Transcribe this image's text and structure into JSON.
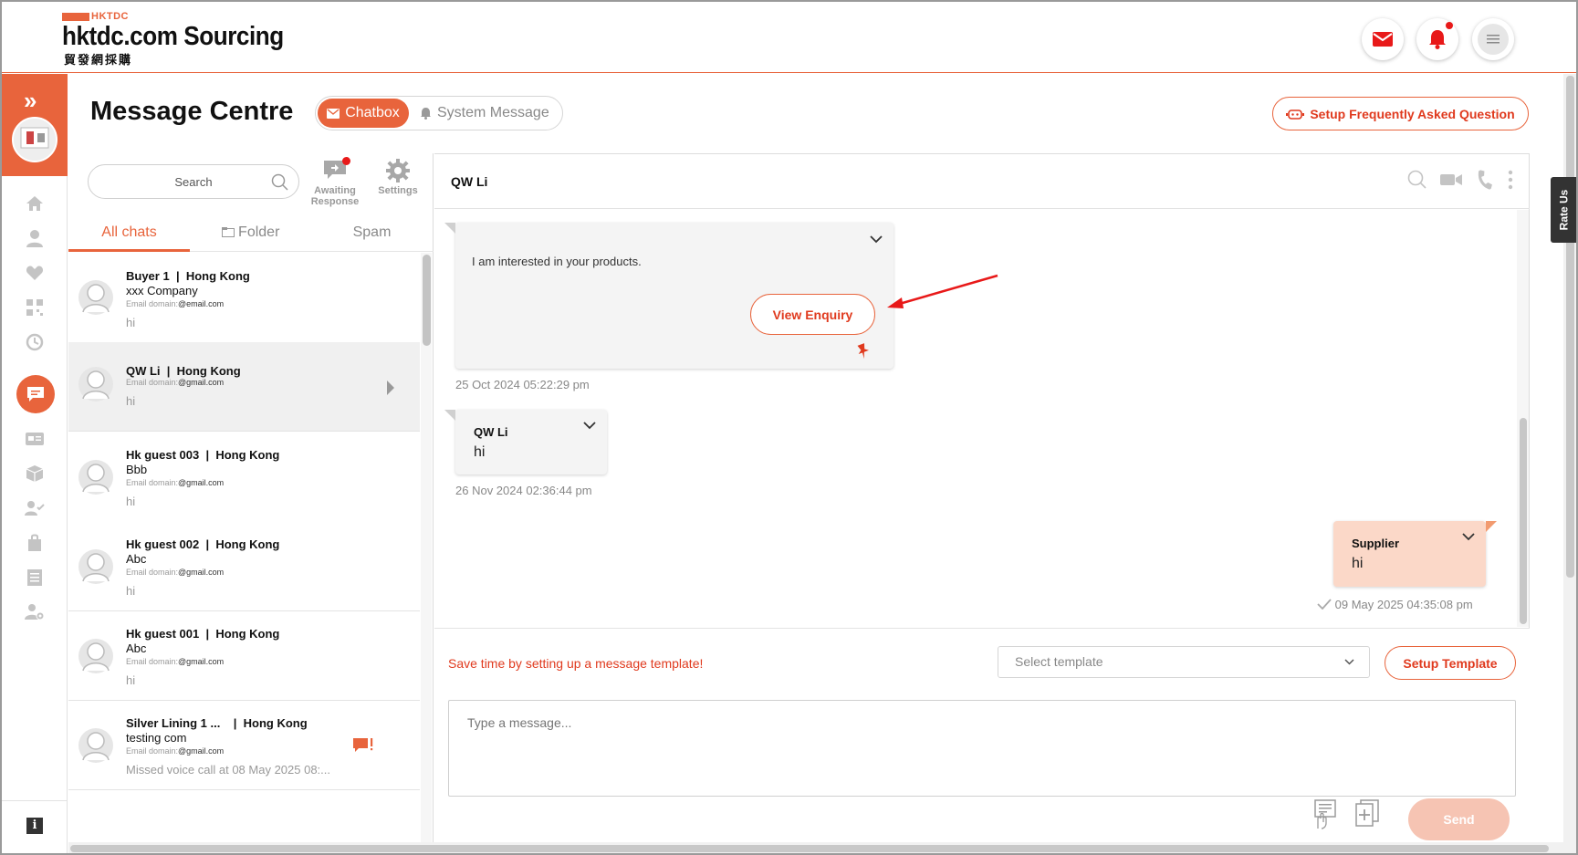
{
  "header": {
    "logo_small": "HKTDC",
    "logo_main": "hktdc.com Sourcing",
    "logo_cn": "貿發網採購",
    "icons": [
      "mail-icon",
      "bell-icon",
      "menu-icon"
    ],
    "accent": "#e8643c"
  },
  "rail": {
    "icons": [
      "home-icon",
      "user-icon",
      "heart-icon",
      "qr-icon",
      "history-icon",
      "chat-icon",
      "card-icon",
      "box-icon",
      "user-check-icon",
      "bag-icon",
      "list-icon",
      "users-gear-icon"
    ],
    "info_label": "i"
  },
  "page": {
    "title": "Message Centre",
    "tab_chatbox": "Chatbox",
    "tab_system": "System Message",
    "faq_button": "Setup Frequently Asked Question"
  },
  "list": {
    "search_placeholder": "Search",
    "awaiting_label_1": "Awaiting",
    "awaiting_label_2": "Response",
    "settings_label": "Settings",
    "tabs": [
      "All chats",
      "Folder",
      "Spam"
    ],
    "email_prefix": "Email domain:",
    "chats": [
      {
        "name": "Buyer 1",
        "sep": "|",
        "region": "Hong Kong",
        "company": "xxx Company",
        "email": "@email.com",
        "last": "hi"
      },
      {
        "name": "QW Li",
        "sep": "|",
        "region": "Hong Kong",
        "company": "",
        "email": "@gmail.com",
        "last": "hi"
      },
      {
        "name": "Hk guest 003",
        "sep": "|",
        "region": "Hong Kong",
        "company": "Bbb",
        "email": "@gmail.com",
        "last": "hi"
      },
      {
        "name": "Hk guest 002",
        "sep": "|",
        "region": "Hong Kong",
        "company": "Abc",
        "email": "@gmail.com",
        "last": "hi"
      },
      {
        "name": "Hk guest 001",
        "sep": "|",
        "region": "Hong Kong",
        "company": "Abc",
        "email": "@gmail.com",
        "last": "hi"
      },
      {
        "name": "Silver Lining 1 ...",
        "sep": "|",
        "region": "Hong Kong",
        "company": "testing com",
        "email": "@gmail.com",
        "last": "Missed voice call at 08 May 2025 08:..."
      }
    ]
  },
  "conversation": {
    "title": "QW Li",
    "enquiry_text": "I am interested in your products.",
    "view_enquiry": "View Enquiry",
    "ts1": "25 Oct 2024 05:22:29 pm",
    "msg2_name": "QW Li",
    "msg2_text": "hi",
    "ts2": "26 Nov 2024 02:36:44 pm",
    "msg3_name": "Supplier",
    "msg3_text": "hi",
    "ts3": "09 May 2025 04:35:08 pm",
    "template_hint": "Save time by setting up a message template!",
    "select_template": "Select template",
    "setup_template": "Setup Template",
    "input_placeholder": "Type a message...",
    "send": "Send"
  },
  "rate_us": "Rate Us"
}
